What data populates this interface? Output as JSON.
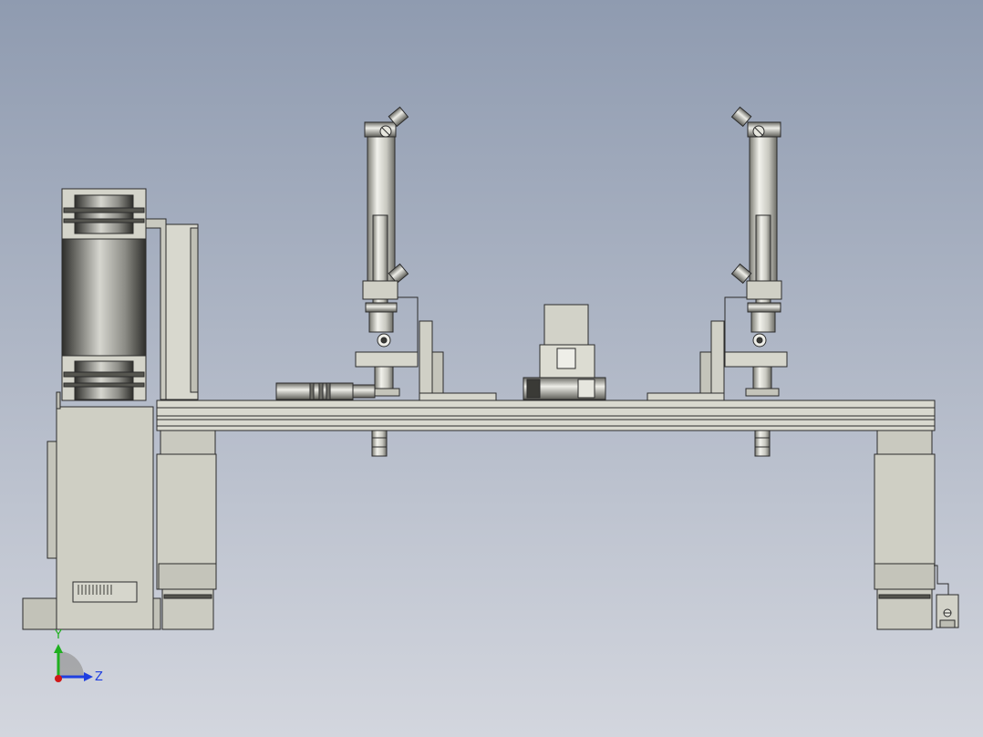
{
  "viewport": {
    "background_top": "#8f9bb0",
    "background_bottom": "#d3d6de"
  },
  "colors": {
    "part_fill": "#cfcfc4",
    "part_fill_dark": "#b4b4aa",
    "edge": "#2b2b2b",
    "steel_light": "#e8e8e2",
    "steel_dark": "#6e6e68",
    "motor_dark": "#3a3a36"
  },
  "triad": {
    "y_label": "Y",
    "z_label": "Z",
    "y_color": "#1fb01f",
    "z_color": "#1f3fe0",
    "x_color": "#d01818"
  }
}
